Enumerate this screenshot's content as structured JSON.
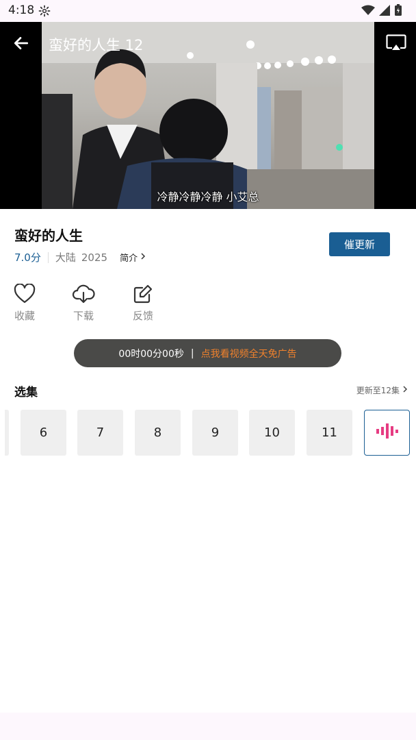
{
  "status_bar": {
    "time": "4:18"
  },
  "player": {
    "title": "蛮好的人生 12",
    "subtitle": "冷静冷静冷静 小艾总"
  },
  "show": {
    "title": "蛮好的人生",
    "rating": "7.0分",
    "region": "大陆",
    "year": "2025",
    "intro_label": "简介",
    "update_button": "催更新"
  },
  "actions": [
    {
      "label": "收藏",
      "icon": "heart-icon"
    },
    {
      "label": "下载",
      "icon": "cloud-download-icon"
    },
    {
      "label": "反馈",
      "icon": "edit-feedback-icon"
    }
  ],
  "ad_banner": {
    "timer": "00时00分00秒",
    "divider": "|",
    "link": "点我看视频全天免广告"
  },
  "episodes": {
    "title": "选集",
    "update_status": "更新至12集",
    "items": [
      "6",
      "7",
      "8",
      "9",
      "10",
      "11"
    ],
    "current_indicator": "playing-bars-icon"
  },
  "colors": {
    "accent": "#1a5e93",
    "ad_link": "#f0812c",
    "playing": "#e63c82"
  }
}
